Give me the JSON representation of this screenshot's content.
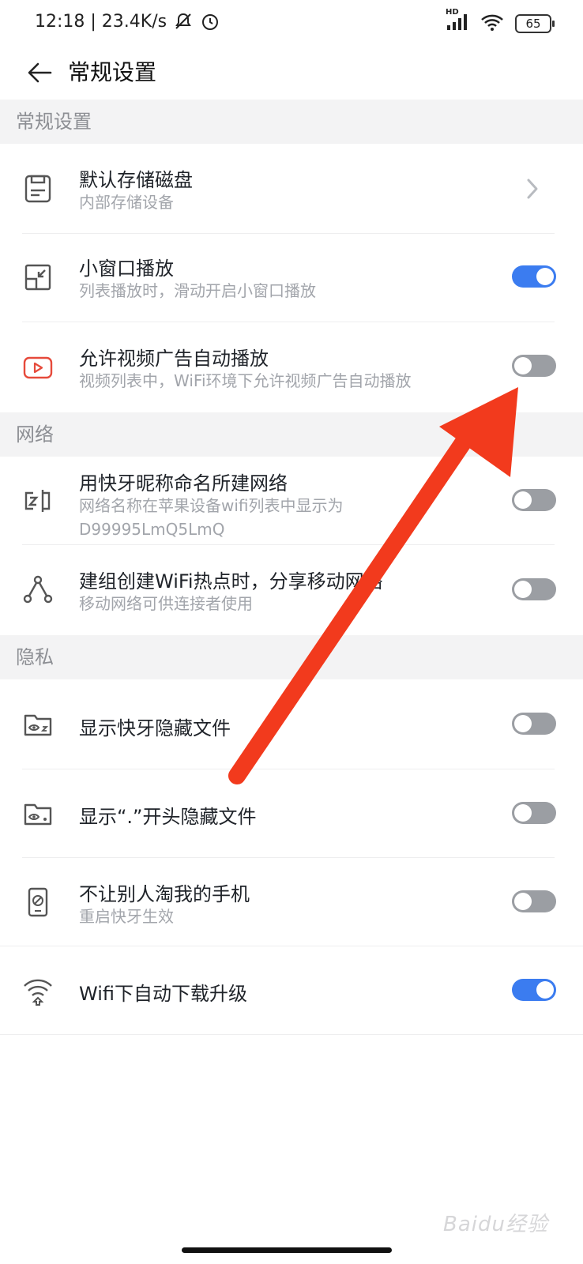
{
  "status": {
    "time_speed": "12:18 | 23.4K/s",
    "network": "HD",
    "battery": "65"
  },
  "header": {
    "title": "常规设置"
  },
  "sections": {
    "general": "常规设置",
    "network": "网络",
    "privacy": "隐私"
  },
  "items": {
    "storage": {
      "title": "默认存储磁盘",
      "subtitle": "内部存储设备"
    },
    "mini_window": {
      "title": "小窗口播放",
      "subtitle": "列表播放时，滑动开启小窗口播放",
      "enabled": true
    },
    "video_ads": {
      "title": "允许视频广告自动播放",
      "subtitle": "视频列表中，WiFi环境下允许视频广告自动播放",
      "enabled": false
    },
    "nickname_network": {
      "title": "用快牙昵称命名所建网络",
      "subtitle": "网络名称在苹果设备wifi列表中显示为 D99995LmQ5LmQ",
      "enabled": false
    },
    "share_mobile": {
      "title": "建组创建WiFi热点时，分享移动网络",
      "subtitle": "移动网络可供连接者使用",
      "enabled": false
    },
    "show_hidden": {
      "title": "显示快牙隐藏文件",
      "enabled": false
    },
    "show_dot_hidden": {
      "title": "显示“.”开头隐藏文件",
      "enabled": false
    },
    "anti_theft": {
      "title": "不让别人淘我的手机",
      "subtitle": "重启快牙生效",
      "enabled": false
    },
    "auto_upgrade": {
      "title": "Wifi下自动下载升级",
      "enabled": true
    }
  },
  "watermark": "Baidu经验",
  "colors": {
    "toggle_on": "#3b7cf0",
    "toggle_off": "#9b9ea3",
    "arrow": "#f23a1d",
    "section_bg": "#f3f3f4"
  }
}
